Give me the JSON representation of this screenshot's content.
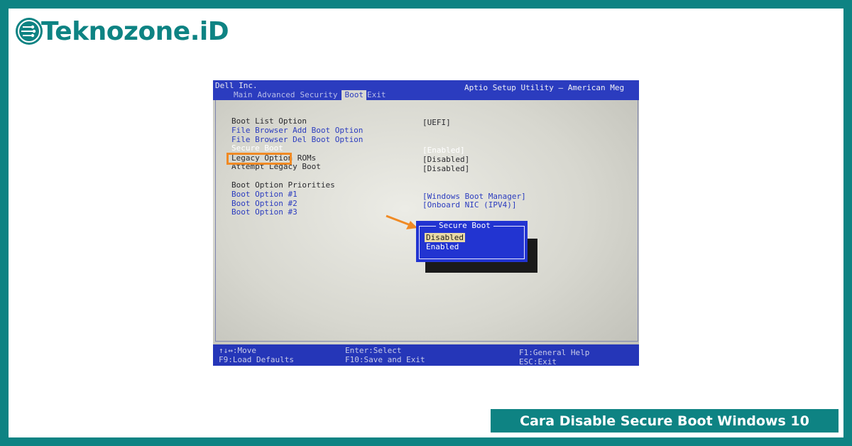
{
  "brand": {
    "name": "Teknozone.iD",
    "icon": "circuit-logo-icon"
  },
  "bios": {
    "vendor": "Dell Inc.",
    "utility_title": "Aptio Setup Utility – American Meg",
    "tabs": [
      {
        "label": "Main",
        "active": false
      },
      {
        "label": "Advanced",
        "active": false
      },
      {
        "label": "Security",
        "active": false
      },
      {
        "label": "Boot",
        "active": true
      },
      {
        "label": "Exit",
        "active": false
      }
    ],
    "options": [
      {
        "label": "Boot List Option",
        "value": "[UEFI]"
      },
      {
        "label": "File Browser Add Boot Option",
        "value": ""
      },
      {
        "label": "File Browser Del Boot Option",
        "value": ""
      },
      {
        "label": "Secure Boot",
        "value": "[Enabled]"
      },
      {
        "label": "Legacy Option ROMs",
        "value": "[Disabled]"
      },
      {
        "label": "Attempt Legacy Boot",
        "value": "[Disabled]"
      },
      {
        "label": "Boot Option Priorities",
        "value": ""
      },
      {
        "label": "Boot Option #1",
        "value": "[Windows Boot Manager]"
      },
      {
        "label": "Boot Option #2",
        "value": "[Onboard NIC (IPV4)]"
      },
      {
        "label": "Boot Option #3",
        "value": ""
      }
    ],
    "popup": {
      "title": "Secure Boot",
      "items": [
        "Disabled",
        "Enabled"
      ],
      "selected": "Disabled"
    },
    "footer": {
      "move": "↑↓↔:Move",
      "load_defaults": "F9:Load Defaults",
      "select": "Enter:Select",
      "save_exit": "F10:Save and Exit",
      "help": "F1:General Help",
      "exit": "ESC:Exit"
    }
  },
  "caption": "Cara Disable Secure Boot Windows 10",
  "colors": {
    "accent": "#0e8383",
    "bios_blue": "#2b3cbf",
    "highlight": "#f08a24"
  }
}
